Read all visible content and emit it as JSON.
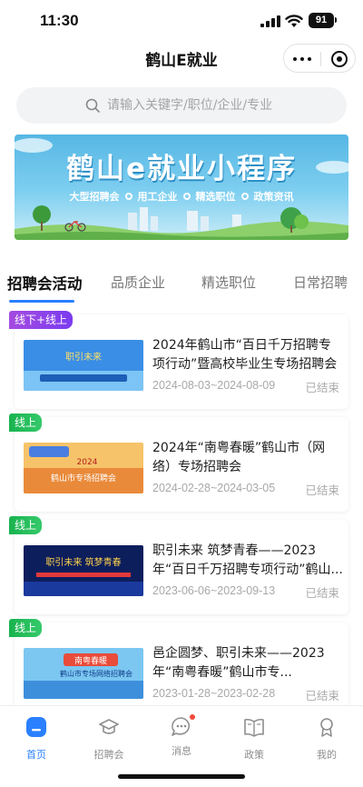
{
  "status_bar": {
    "time": "11:30",
    "battery": "91"
  },
  "nav": {
    "title": "鹤山E就业",
    "more_icon": "more-dots-icon",
    "close_icon": "target-circle-icon"
  },
  "search": {
    "placeholder": "请输入关键字/职位/企业/专业",
    "icon": "search-icon"
  },
  "banner": {
    "title": "鹤山e就业小程序",
    "tags": [
      "大型招聘会",
      "用工企业",
      "精选职位",
      "政策资讯"
    ]
  },
  "tabs": [
    {
      "label": "招聘会活动",
      "active": true
    },
    {
      "label": "品质企业",
      "active": false
    },
    {
      "label": "精选职位",
      "active": false
    },
    {
      "label": "日常招聘",
      "active": false
    }
  ],
  "events": [
    {
      "badge": "线下+线上",
      "badge_color": "#8a40ea",
      "title": "2024年鹤山市“百日千万招聘专项行动”暨高校毕业生专场招聘会",
      "date": "2024-08-03~2024-08-09",
      "status": "已结束"
    },
    {
      "badge": "线上",
      "badge_color": "#22b85a",
      "title": "2024年“南粤春暖”鹤山市（网络）专场招聘会",
      "date": "2024-02-28~2024-03-05",
      "status": "已结束"
    },
    {
      "badge": "线上",
      "badge_color": "#22b85a",
      "title": "职引未来 筑梦青春——2023年“百日千万招聘专项行动”鹤山...",
      "date": "2023-06-06~2023-09-13",
      "status": "已结束"
    },
    {
      "badge": "线上",
      "badge_color": "#22b85a",
      "title": "邑企圆梦、职引未来——2023 年“南粤春暖”鹤山市专...",
      "date": "2023-01-28~2023-02-28",
      "status": "已结束"
    }
  ],
  "bottom_nav": [
    {
      "label": "首页",
      "icon": "home-icon",
      "active": true
    },
    {
      "label": "招聘会",
      "icon": "graduation-cap-icon",
      "active": false
    },
    {
      "label": "消息",
      "icon": "message-icon",
      "active": false,
      "dot": true
    },
    {
      "label": "政策",
      "icon": "book-icon",
      "active": false
    },
    {
      "label": "我的",
      "icon": "user-icon",
      "active": false
    }
  ],
  "colors": {
    "accent": "#2a80ff",
    "badge_purple": "#8a40ea",
    "badge_green": "#22b85a"
  }
}
